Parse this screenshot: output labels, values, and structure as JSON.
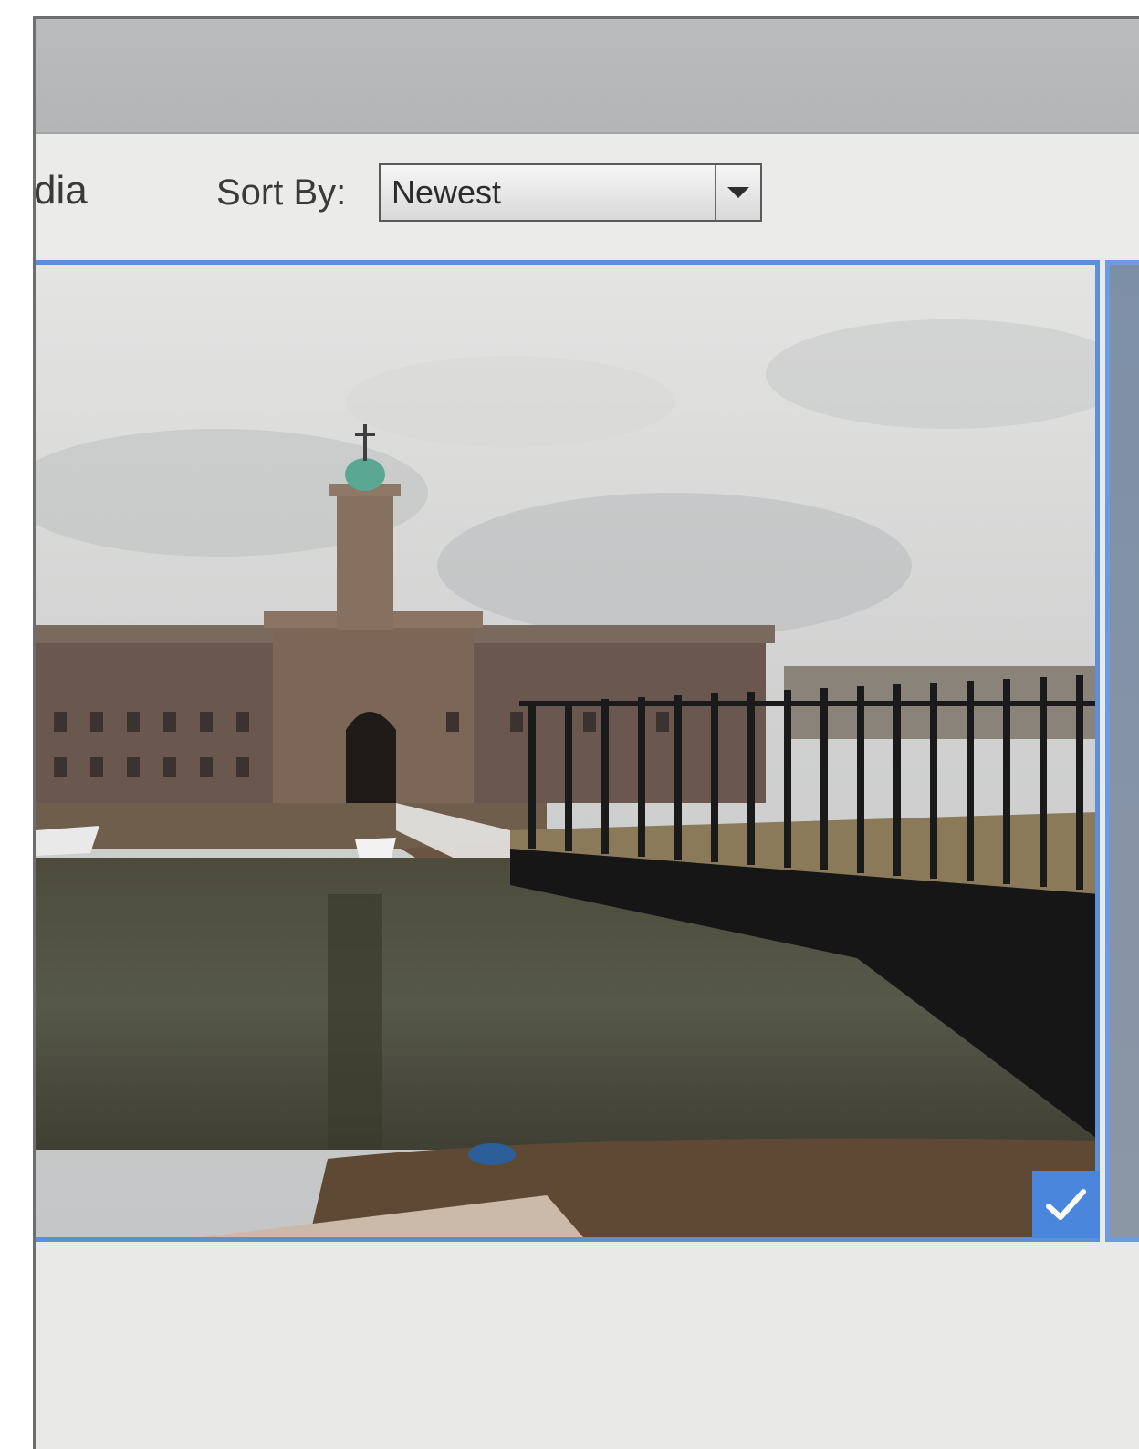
{
  "window": {
    "title": ""
  },
  "toolbar": {
    "media_label": "dia",
    "sort_label": "Sort By:",
    "sort_value": "Newest"
  },
  "gallery": {
    "items": [
      {
        "selected": true,
        "selection_icon": "checkmark-icon"
      }
    ]
  },
  "colors": {
    "selection_border": "#5d8fd6",
    "check_badge": "#4a86db",
    "titlebar": "#b7b9bb",
    "panel_background": "#e9e9e8"
  },
  "icons": {
    "sort_dropdown": "chevron-down-icon",
    "selected_badge": "checkmark-icon"
  }
}
